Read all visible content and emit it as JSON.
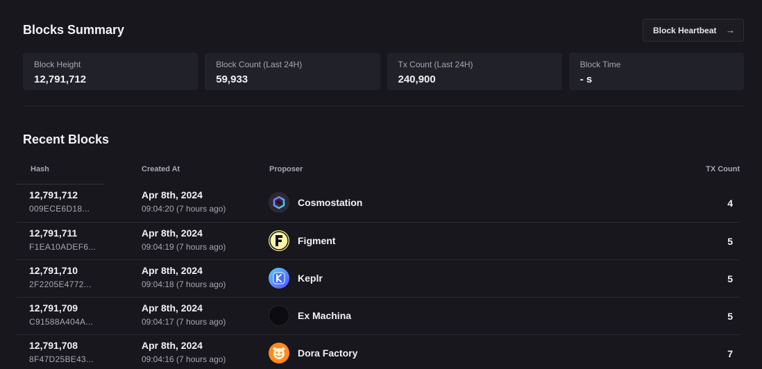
{
  "summary": {
    "title": "Blocks Summary",
    "heartbeat_label": "Block Heartbeat",
    "stats": [
      {
        "label": "Block Height",
        "value": "12,791,712"
      },
      {
        "label": "Block Count (Last 24H)",
        "value": "59,933"
      },
      {
        "label": "Tx Count (Last 24H)",
        "value": "240,900"
      },
      {
        "label": "Block Time",
        "value": "- s"
      }
    ]
  },
  "recent": {
    "title": "Recent Blocks",
    "columns": {
      "hash": "Hash",
      "created": "Created At",
      "proposer": "Proposer",
      "tx": "TX Count"
    },
    "rows": [
      {
        "height": "12,791,712",
        "hash": "009ECE6D18...",
        "date": "Apr 8th, 2024",
        "time": "09:04:20 (7 hours ago)",
        "proposer": "Cosmostation",
        "tx": "4"
      },
      {
        "height": "12,791,711",
        "hash": "F1EA10ADEF6...",
        "date": "Apr 8th, 2024",
        "time": "09:04:19 (7 hours ago)",
        "proposer": "Figment",
        "tx": "5"
      },
      {
        "height": "12,791,710",
        "hash": "2F2205E4772...",
        "date": "Apr 8th, 2024",
        "time": "09:04:18 (7 hours ago)",
        "proposer": "Keplr",
        "tx": "5"
      },
      {
        "height": "12,791,709",
        "hash": "C91588A404A...",
        "date": "Apr 8th, 2024",
        "time": "09:04:17 (7 hours ago)",
        "proposer": "Ex Machina",
        "tx": "5"
      },
      {
        "height": "12,791,708",
        "hash": "8F47D25BE43...",
        "date": "Apr 8th, 2024",
        "time": "09:04:16 (7 hours ago)",
        "proposer": "Dora Factory",
        "tx": "7"
      }
    ]
  },
  "icons": {
    "heartbeat_arrow": "arrow-right-icon"
  },
  "colors": {
    "background": "#17171d",
    "card": "#212129",
    "muted_text": "#a8a8b3"
  }
}
